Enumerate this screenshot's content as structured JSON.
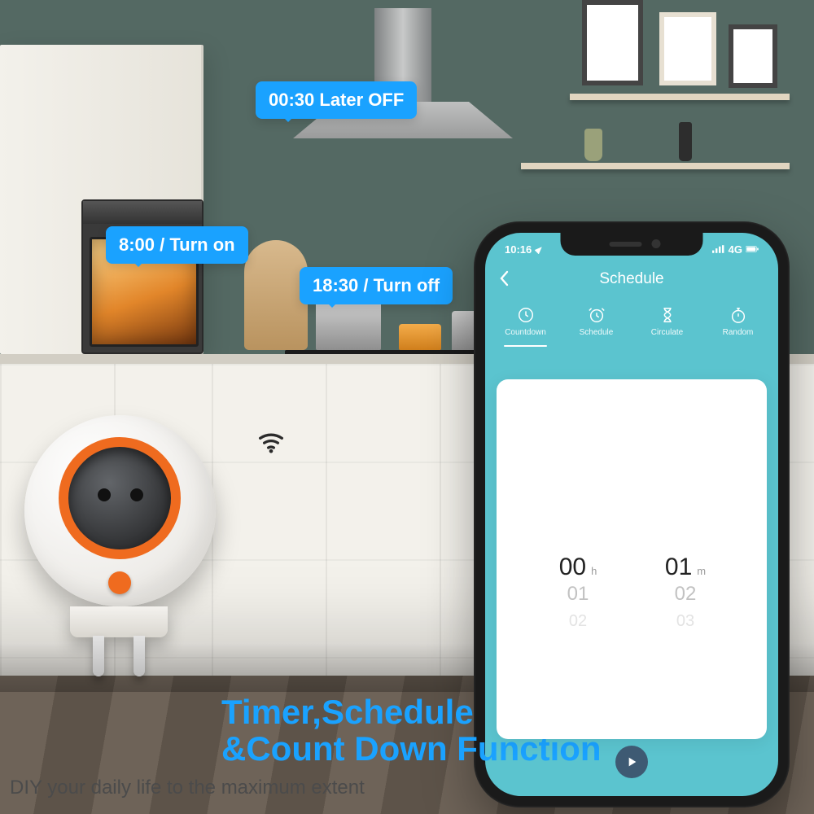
{
  "bubbles": {
    "b1": "00:30 Later OFF",
    "b2": "8:00 / Turn on",
    "b3": "18:30 / Turn off"
  },
  "phone": {
    "status": {
      "time": "10:16",
      "carrier": "4G"
    },
    "header": {
      "title": "Schedule"
    },
    "tabs": [
      {
        "label": "Countdown"
      },
      {
        "label": "Schedule"
      },
      {
        "label": "Circulate"
      },
      {
        "label": "Random"
      }
    ],
    "picker": {
      "hours": {
        "main": "00",
        "unit": "h",
        "next1": "01",
        "next2": "02"
      },
      "minutes": {
        "main": "01",
        "unit": "m",
        "next1": "02",
        "next2": "03"
      }
    }
  },
  "headline": {
    "line1": "Timer,Schedule",
    "line2": "&Count Down Function"
  },
  "subline": "DIY your daily life to the maximum extent"
}
